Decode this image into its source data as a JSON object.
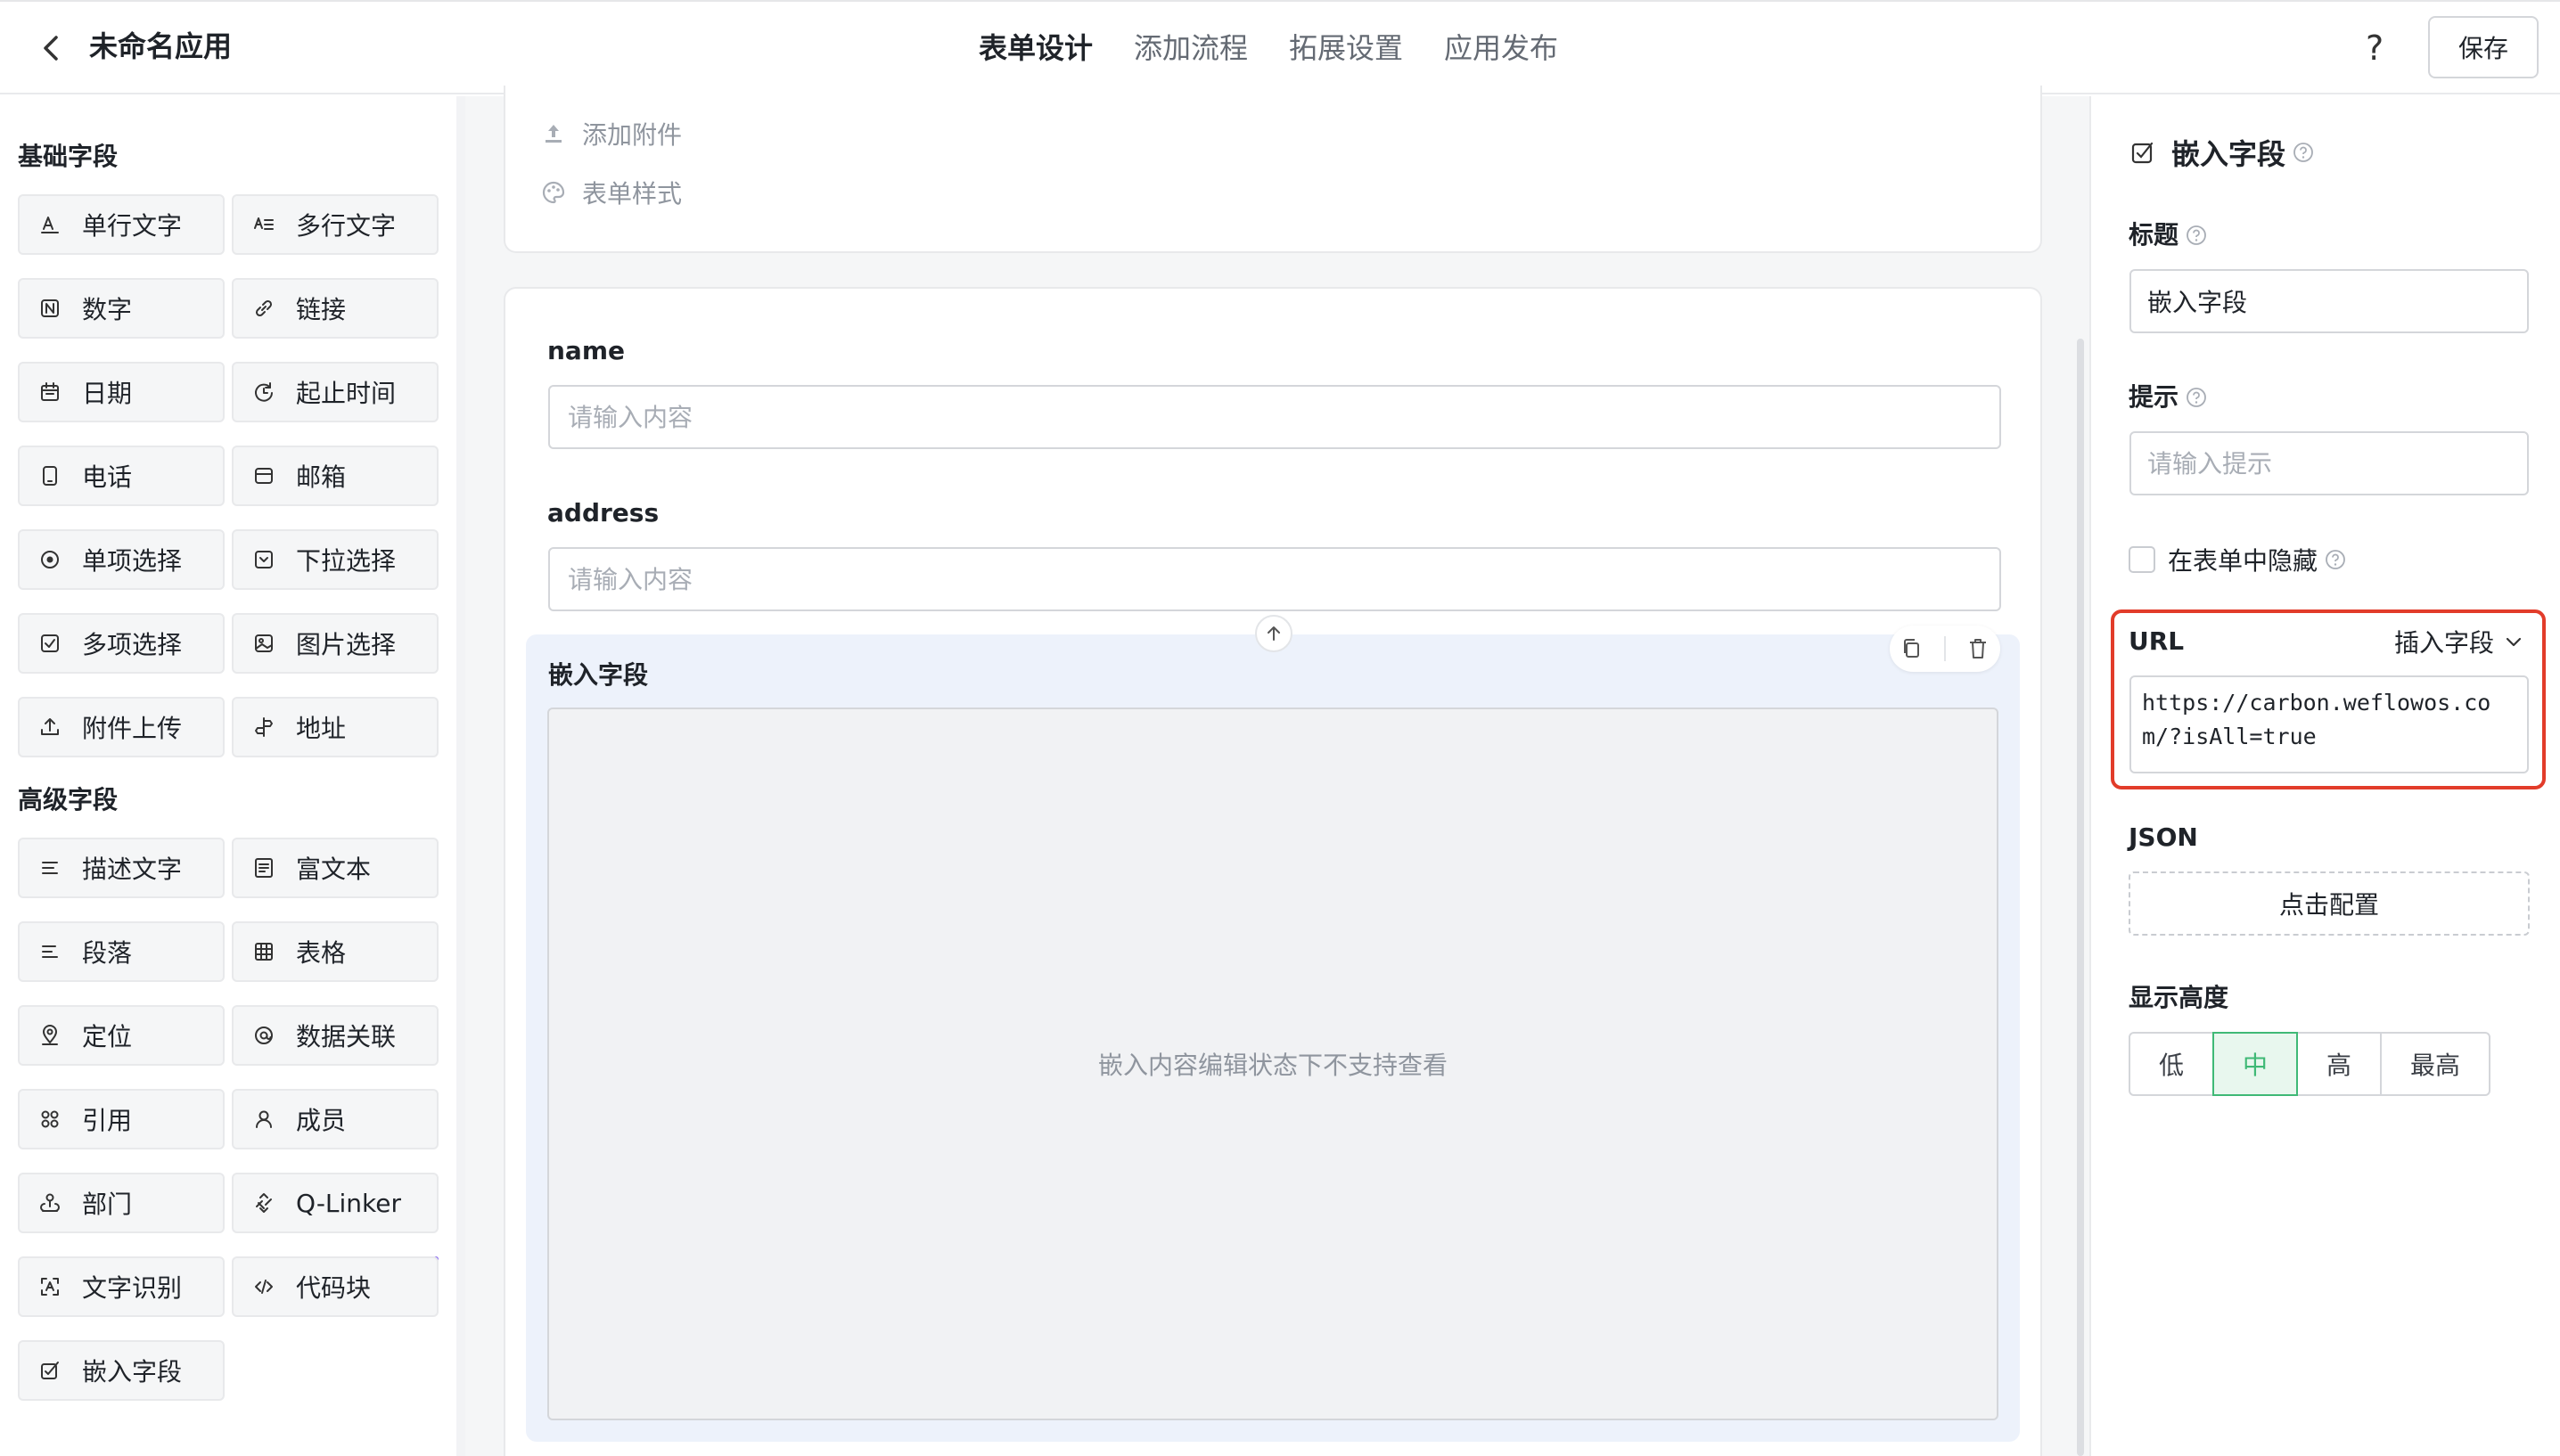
{
  "header": {
    "app_title": "未命名应用",
    "tabs": [
      {
        "label": "表单设计",
        "active": true
      },
      {
        "label": "添加流程",
        "active": false
      },
      {
        "label": "拓展设置",
        "active": false
      },
      {
        "label": "应用发布",
        "active": false
      }
    ],
    "help_label": "?",
    "save_label": "保存"
  },
  "sidebar": {
    "basic_title": "基础字段",
    "basic_fields": [
      {
        "label": "单行文字",
        "icon": "single-line-text-icon"
      },
      {
        "label": "多行文字",
        "icon": "multi-line-text-icon"
      },
      {
        "label": "数字",
        "icon": "number-icon"
      },
      {
        "label": "链接",
        "icon": "link-icon"
      },
      {
        "label": "日期",
        "icon": "calendar-icon"
      },
      {
        "label": "起止时间",
        "icon": "time-range-icon"
      },
      {
        "label": "电话",
        "icon": "phone-icon"
      },
      {
        "label": "邮箱",
        "icon": "mail-icon"
      },
      {
        "label": "单项选择",
        "icon": "radio-icon"
      },
      {
        "label": "下拉选择",
        "icon": "dropdown-icon"
      },
      {
        "label": "多项选择",
        "icon": "checkbox-icon"
      },
      {
        "label": "图片选择",
        "icon": "image-icon"
      },
      {
        "label": "附件上传",
        "icon": "upload-icon"
      },
      {
        "label": "地址",
        "icon": "address-icon"
      }
    ],
    "advanced_title": "高级字段",
    "advanced_fields": [
      {
        "label": "描述文字",
        "icon": "description-icon"
      },
      {
        "label": "富文本",
        "icon": "rich-text-icon"
      },
      {
        "label": "段落",
        "icon": "paragraph-icon"
      },
      {
        "label": "表格",
        "icon": "table-icon"
      },
      {
        "label": "定位",
        "icon": "location-icon"
      },
      {
        "label": "数据关联",
        "icon": "data-link-icon"
      },
      {
        "label": "引用",
        "icon": "reference-icon"
      },
      {
        "label": "成员",
        "icon": "member-icon"
      },
      {
        "label": "部门",
        "icon": "department-icon"
      },
      {
        "label": "Q-Linker",
        "icon": "q-linker-icon"
      },
      {
        "label": "文字识别",
        "icon": "ocr-icon"
      },
      {
        "label": "代码块",
        "icon": "code-block-icon"
      },
      {
        "label": "嵌入字段",
        "icon": "embed-field-icon"
      }
    ]
  },
  "canvas": {
    "top_items": [
      {
        "label": "添加附件",
        "icon": "upload-icon"
      },
      {
        "label": "表单样式",
        "icon": "palette-icon"
      }
    ],
    "fields": [
      {
        "label": "name",
        "placeholder": "请输入内容"
      },
      {
        "label": "address",
        "placeholder": "请输入内容"
      }
    ],
    "embed_title": "嵌入字段",
    "embed_placeholder": "嵌入内容编辑状态下不支持查看"
  },
  "panel": {
    "title": "嵌入字段",
    "title_label": "标题",
    "title_value": "嵌入字段",
    "hint_label": "提示",
    "hint_placeholder": "请输入提示",
    "hide_label": "在表单中隐藏",
    "hide_checked": false,
    "url_label": "URL",
    "insert_label": "插入字段",
    "url_value": "https://carbon.weflowos.com/?isAll=true",
    "json_label": "JSON",
    "config_label": "点击配置",
    "height_label": "显示高度",
    "height_options": [
      "低",
      "中",
      "高",
      "最高"
    ],
    "height_selected": "中"
  },
  "colors": {
    "accent": "#3fb976",
    "highlight_border": "#e23c2a",
    "embed_bg": "#edf2fb"
  }
}
